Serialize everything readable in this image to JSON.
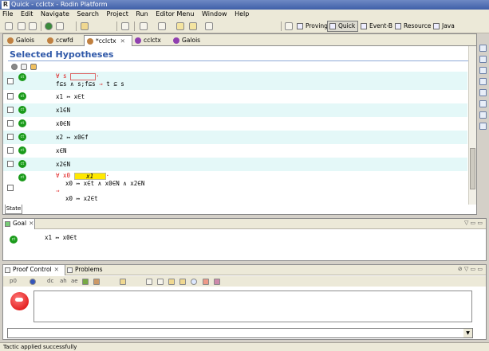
{
  "window": {
    "title": "Quick - cclctx - Rodin Platform",
    "app_icon": "R"
  },
  "menu": [
    "File",
    "Edit",
    "Navigate",
    "Search",
    "Project",
    "Run",
    "Editor Menu",
    "Window",
    "Help"
  ],
  "perspectives": [
    {
      "label": "Proving",
      "active": false
    },
    {
      "label": "Quick",
      "active": true
    },
    {
      "label": "Event-B",
      "active": false
    },
    {
      "label": "Resource",
      "active": false
    },
    {
      "label": "Java",
      "active": false
    }
  ],
  "editor_tabs": [
    {
      "label": "Galois",
      "active": false
    },
    {
      "label": "ccwfd",
      "active": false
    },
    {
      "label": "*cclctx",
      "active": true,
      "close": "✕"
    },
    {
      "label": "cclctx",
      "active": false
    },
    {
      "label": "Galois",
      "active": false
    }
  ],
  "selected_hypotheses": {
    "title": "Selected Hypotheses",
    "hyp_button": "ct",
    "rows": [
      {
        "l1_pre": "∀ s ",
        "l1_post": "·",
        "l2_a": "f⊆s ∧ s;f⊆s ",
        "l2_arrow": "⇒",
        "l2_b": " t ⊆ s"
      },
      {
        "text": "x1 ↦ x∈t"
      },
      {
        "text": "x1∈N"
      },
      {
        "text": "x0∈N"
      },
      {
        "text": "x2 ↦ x0∈f"
      },
      {
        "text": "x∈N"
      },
      {
        "text": "x2∈N"
      },
      {
        "l1_pre": "∀ x0 ",
        "box": "x1",
        "l1_post": "·",
        "l2": "x0 ↦ x∈t ∧ x0∈N ∧ x2∈N",
        "arrow": "⇒",
        "l4": "x0 ↦ x2∈t"
      }
    ]
  },
  "state_tab": "State",
  "goal": {
    "tab": "Goal",
    "button": "ct",
    "text": "x1 ↦ x0∈t"
  },
  "proof_control": {
    "tabs": [
      "Proof Control",
      "Problems"
    ],
    "toolbar_labels": [
      "p0",
      "dc",
      "ah",
      "ae"
    ],
    "message": "",
    "combo_value": ""
  },
  "status": "Tactic applied successfully",
  "colors": {
    "accent": "#2f58a8",
    "hyp_alt": "#e4f8f8",
    "green_button": "#1a9a1a",
    "red_operator": "#dd1111",
    "box_yellow": "#ffe800"
  }
}
